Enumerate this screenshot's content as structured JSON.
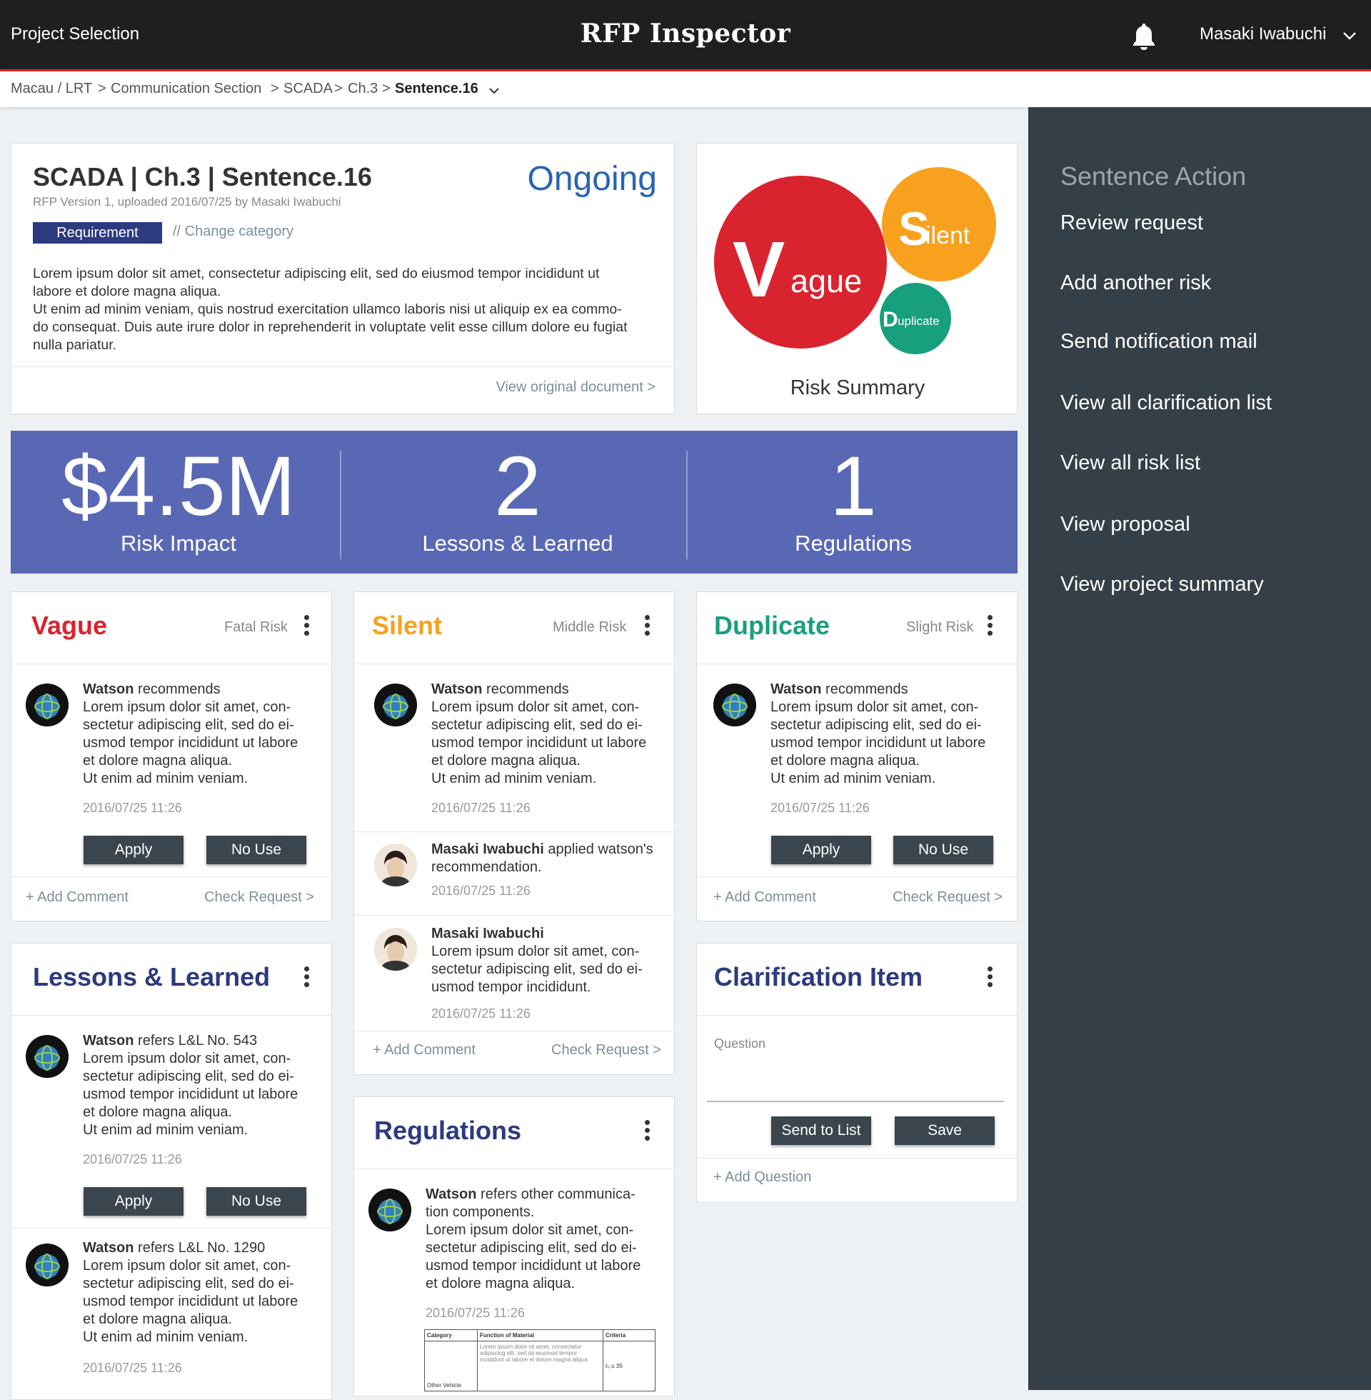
{
  "header": {
    "project_selection": "Project Selection",
    "app_title": "RFP Inspector",
    "user_name": "Masaki Iwabuchi"
  },
  "breadcrumb": {
    "items": [
      "Macau / LRT",
      ">",
      "Communication Section",
      ">",
      "SCADA",
      ">",
      "Ch.3",
      ">",
      "Sentence.16"
    ]
  },
  "main_card": {
    "title": "SCADA | Ch.3 | Sentence.16",
    "subtitle": "RFP Version 1, uploaded 2016/07/25 by Masaki Iwabuchi",
    "status": "Ongoing",
    "category": "Requirement",
    "change_category": "// Change category",
    "body_lines": [
      "Lorem ipsum dolor sit amet, consectetur adipiscing elit, sed do eiusmod tempor incididunt ut",
      "labore et dolore magna aliqua.",
      "Ut enim ad minim veniam, quis nostrud exercitation ullamco laboris nisi ut aliquip ex ea commo-",
      "do consequat. Duis aute irure dolor in reprehenderit in voluptate velit esse cillum dolore eu fugiat",
      "nulla pariatur."
    ],
    "view_original": "View original document >"
  },
  "risk_summary": {
    "label": "Risk Summary",
    "vague": {
      "initial": "V",
      "rest": "ague",
      "color": "#d9232e"
    },
    "silent": {
      "initial": "S",
      "rest": "ilent",
      "color": "#f7a11f"
    },
    "duplicate": {
      "initial": "D",
      "rest": "uplicate",
      "color": "#18a07e"
    }
  },
  "stats": {
    "risk_impact": {
      "value": "$4.5M",
      "label": "Risk Impact"
    },
    "lessons": {
      "value": "2",
      "label": "Lessons & Learned"
    },
    "regulations": {
      "value": "1",
      "label": "Regulations"
    }
  },
  "common": {
    "apply": "Apply",
    "no_use": "No Use",
    "add_comment": "+ Add Comment",
    "check_request": "Check Request >",
    "watson": "Watson",
    "recommends": "recommends",
    "timestamp": "2016/07/25 11:26",
    "lorem_lines": [
      "Lorem ipsum dolor sit amet, con-",
      "sectetur adipiscing elit, sed do ei-",
      "usmod tempor incididunt ut labore",
      "et dolore magna aliqua.",
      "Ut enim ad minim veniam."
    ]
  },
  "vague_card": {
    "title": "Vague",
    "level": "Fatal Risk",
    "color": "#d9232e"
  },
  "silent_card": {
    "title": "Silent",
    "level": "Middle Risk",
    "color": "#f7a11f",
    "applied_name": "Masaki Iwabuchi",
    "applied_text_1": " applied watson's",
    "applied_text_2": "recommendation.",
    "comment_name": "Masaki Iwabuchi",
    "comment_lines": [
      "Lorem ipsum dolor sit amet, con-",
      "sectetur adipiscing elit, sed do ei-",
      "usmod tempor incididunt."
    ]
  },
  "duplicate_card": {
    "title": "Duplicate",
    "level": "Slight Risk",
    "color": "#18a07e"
  },
  "lessons_card": {
    "title": "Lessons & Learned",
    "refers": "refers L&L No. 543",
    "refers2": "refers L&L No. 1290"
  },
  "regulations_card": {
    "title": "Regulations",
    "intro_1": " refers other communica-",
    "intro_2": "tion components.",
    "lines": [
      "Lorem ipsum dolor sit amet, con-",
      "sectetur adipiscing elit, sed do ei-",
      "usmod tempor incididunt ut labore",
      "et dolore magna aliqua."
    ],
    "table": {
      "headers": [
        "Category",
        "Function of Material",
        "Criteria"
      ],
      "row_desc": "Lorem ipsum dolor sit amet, consectetur adipiscing elit, sed do eiusmod tempor incididunt ut labore et dolore magna aliqua.",
      "row_criteria": "ℓ₀ ≤ 35",
      "row_category": "Other Vehicle"
    }
  },
  "clarification_card": {
    "title": "Clarification Item",
    "question_label": "Question",
    "send_to_list": "Send to List",
    "save": "Save",
    "add_question": "+ Add Question"
  },
  "sidebar": {
    "title": "Sentence Action",
    "items": [
      "Review request",
      "Add another risk",
      "Send notification mail",
      "View all clarification list",
      "View all risk list",
      "View proposal",
      "View project summary"
    ]
  },
  "colors": {
    "accent_red": "#e5262e",
    "navy": "#2c3a7e",
    "stats_bg": "#5968b5",
    "sidebar_bg": "#353f47"
  }
}
